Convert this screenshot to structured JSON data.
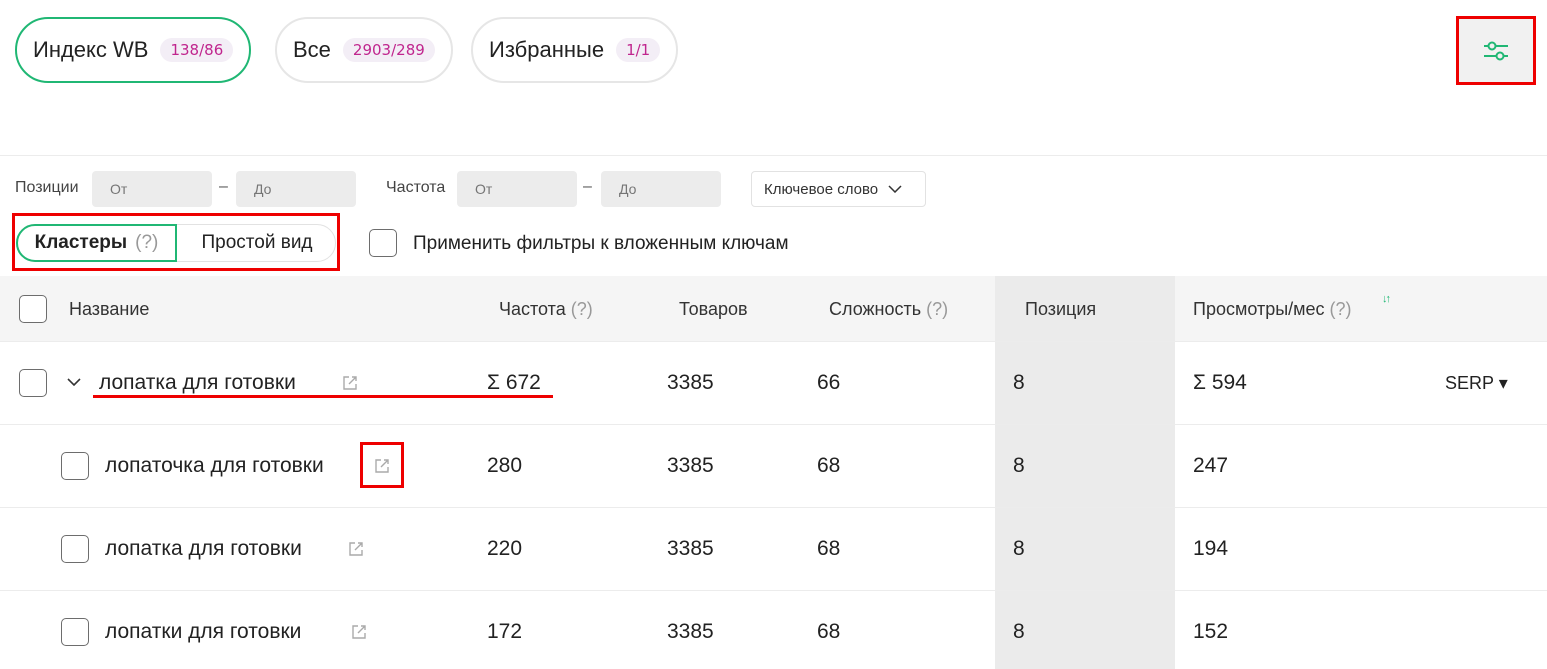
{
  "segments": [
    {
      "label": "Индекс WB",
      "count": "138/86"
    },
    {
      "label": "Все",
      "count": "2903/289"
    },
    {
      "label": "Избранные",
      "count": "1/1"
    }
  ],
  "filters": {
    "positions_label": "Позиции",
    "frequency_label": "Частота",
    "from_placeholder": "От",
    "to_placeholder": "До",
    "dash": "–",
    "keyword_select": "Ключевое слово"
  },
  "view": {
    "clusters": "Кластеры",
    "clusters_help": "(?)",
    "simple": "Простой вид",
    "apply_nested": "Применить фильтры к вложенным ключам"
  },
  "table": {
    "headers": {
      "name": "Название",
      "frequency": "Частота",
      "frequency_help": "(?)",
      "products": "Товаров",
      "difficulty": "Сложность",
      "difficulty_help": "(?)",
      "position": "Позиция",
      "views": "Просмотры/мес",
      "views_help": "(?)",
      "sort_glyph": "↓↑"
    },
    "cluster": {
      "name": "лопатка для готовки",
      "frequency": "Σ 672",
      "products": "3385",
      "difficulty": "66",
      "position": "8",
      "views": "Σ 594",
      "serp": "SERP ▾"
    },
    "rows": [
      {
        "name": "лопаточка для готовки",
        "frequency": "280",
        "products": "3385",
        "difficulty": "68",
        "position": "8",
        "views": "247"
      },
      {
        "name": "лопатка для готовки",
        "frequency": "220",
        "products": "3385",
        "difficulty": "68",
        "position": "8",
        "views": "194"
      },
      {
        "name": "лопатки для готовки",
        "frequency": "172",
        "products": "3385",
        "difficulty": "68",
        "position": "8",
        "views": "152"
      }
    ]
  },
  "colors": {
    "accent": "#20b774",
    "count_text": "#c0268e",
    "highlight": "#ee0000"
  }
}
